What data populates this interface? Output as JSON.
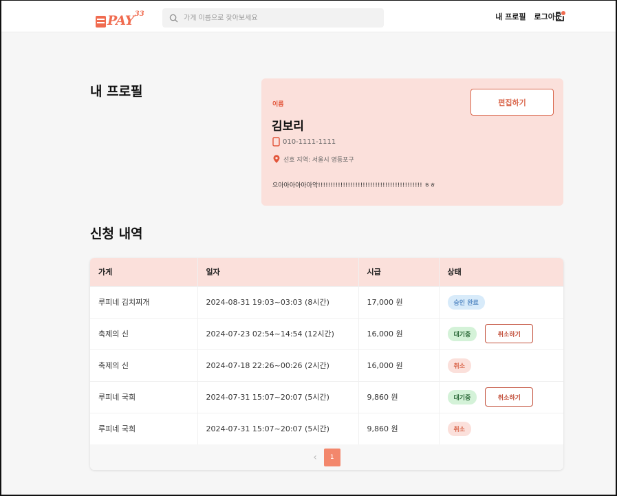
{
  "header": {
    "logo_text": "PAY",
    "logo_sup": "33",
    "search_placeholder": "가게 이름으로 찾아보세요",
    "nav_profile": "내 프로필",
    "nav_logout": "로그아웃"
  },
  "profile": {
    "section_title": "내 프로필",
    "name_label": "이름",
    "name": "김보리",
    "phone": "010-1111-1111",
    "region": "선호 지역: 서울시 영등포구",
    "bio": "으아아아아아아악!!!!!!!!!!!!!!!!!!!!!!!!!!!!!!!!!!!!!!!!!! ㅎㅎ",
    "edit_button": "편집하기"
  },
  "applications": {
    "section_title": "신청 내역",
    "columns": [
      "가게",
      "일자",
      "시급",
      "상태"
    ],
    "rows": [
      {
        "store": "루피네 김치찌개",
        "date": "2024-08-31 19:03~03:03 (8시간)",
        "wage": "17,000 원",
        "status": "승인 완료",
        "status_type": "approved",
        "action": ""
      },
      {
        "store": "축제의 신",
        "date": "2024-07-23 02:54~14:54 (12시간)",
        "wage": "16,000 원",
        "status": "대기중",
        "status_type": "waiting",
        "action": "취소하기"
      },
      {
        "store": "축제의 신",
        "date": "2024-07-18 22:26~00:26 (2시간)",
        "wage": "16,000 원",
        "status": "취소",
        "status_type": "cancel",
        "action": ""
      },
      {
        "store": "루피네 국희",
        "date": "2024-07-31 15:07~20:07 (5시간)",
        "wage": "9,860 원",
        "status": "대기중",
        "status_type": "waiting",
        "action": "취소하기"
      },
      {
        "store": "루피네 국희",
        "date": "2024-07-31 15:07~20:07 (5시간)",
        "wage": "9,860 원",
        "status": "취소",
        "status_type": "cancel",
        "action": ""
      }
    ],
    "pagination": {
      "prev": "‹",
      "current": "1"
    }
  },
  "colors": {
    "brand": "#f06b4f",
    "card_bg": "#fbe0db",
    "approved": "#5c8fc7",
    "waiting": "#2d6b3a"
  },
  "icons": [
    "search-icon",
    "notification-icon",
    "phone-icon",
    "location-pin-icon",
    "chevron-left-icon"
  ]
}
